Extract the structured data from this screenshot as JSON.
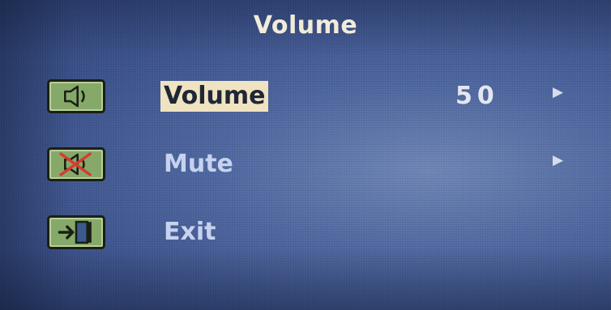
{
  "osd": {
    "title": "Volume",
    "items": [
      {
        "label": "Volume",
        "value": "50",
        "arrow": "▶",
        "icon": "speaker-icon",
        "selected": true
      },
      {
        "label": "Mute",
        "value": "",
        "arrow": "▶",
        "icon": "speaker-muted-icon",
        "selected": false
      },
      {
        "label": "Exit",
        "value": "",
        "arrow": "",
        "icon": "exit-door-icon",
        "selected": false
      }
    ]
  },
  "colors": {
    "background": "#4f67a0",
    "icon_fill": "#86a96a",
    "selected_highlight": "#efe3c1",
    "mute_cross": "#d83a2e"
  }
}
